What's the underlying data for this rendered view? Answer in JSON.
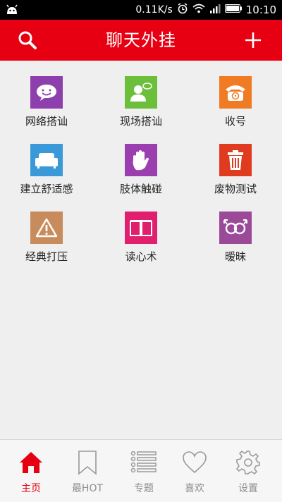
{
  "statusbar": {
    "network_speed": "0.11K/s",
    "time": "10:10"
  },
  "appbar": {
    "title": "聊天外挂",
    "search_icon": "search-icon",
    "add_icon": "plus-icon"
  },
  "colors": {
    "accent": "#e60012",
    "tab_inactive": "#8e8e8e"
  },
  "grid": {
    "items": [
      {
        "label": "网络搭讪",
        "icon": "chat-bubble-icon",
        "color": "#8e3fae"
      },
      {
        "label": "现场搭讪",
        "icon": "person-chat-icon",
        "color": "#6cbf3b"
      },
      {
        "label": "收号",
        "icon": "telephone-icon",
        "color": "#f07b22"
      },
      {
        "label": "建立舒适感",
        "icon": "sofa-icon",
        "color": "#3a9ad9"
      },
      {
        "label": "肢体触碰",
        "icon": "hand-icon",
        "color": "#9b3fb0"
      },
      {
        "label": "废物测试",
        "icon": "trash-icon",
        "color": "#e03b1f"
      },
      {
        "label": "经典打压",
        "icon": "warning-icon",
        "color": "#c88c5c"
      },
      {
        "label": "读心术",
        "icon": "book-icon",
        "color": "#e0206e"
      },
      {
        "label": "暧昧",
        "icon": "gender-icon",
        "color": "#9a4a99"
      }
    ]
  },
  "tabbar": {
    "tabs": [
      {
        "label": "主页",
        "icon": "home-icon",
        "active": true
      },
      {
        "label": "最HOT",
        "icon": "bookmark-icon",
        "active": false
      },
      {
        "label": "专题",
        "icon": "list-icon",
        "active": false
      },
      {
        "label": "喜欢",
        "icon": "heart-icon",
        "active": false
      },
      {
        "label": "设置",
        "icon": "gear-icon",
        "active": false
      }
    ]
  }
}
